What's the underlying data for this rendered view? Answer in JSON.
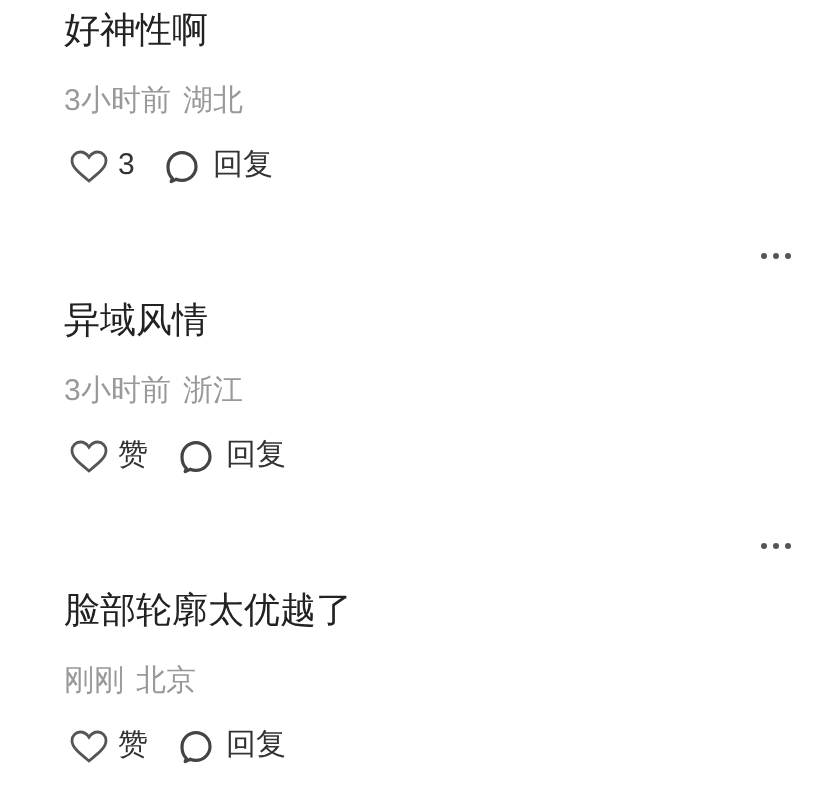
{
  "comments": [
    {
      "menu": false,
      "text": "好神性啊",
      "time": "3小时前",
      "location": "湖北",
      "like_label": "3",
      "reply_label": "回复"
    },
    {
      "menu": true,
      "text": "异域风情",
      "time": "3小时前",
      "location": "浙江",
      "like_label": "赞",
      "reply_label": "回复"
    },
    {
      "menu": true,
      "text": "脸部轮廓太优越了",
      "time": "刚刚",
      "location": "北京",
      "like_label": "赞",
      "reply_label": "回复"
    }
  ]
}
